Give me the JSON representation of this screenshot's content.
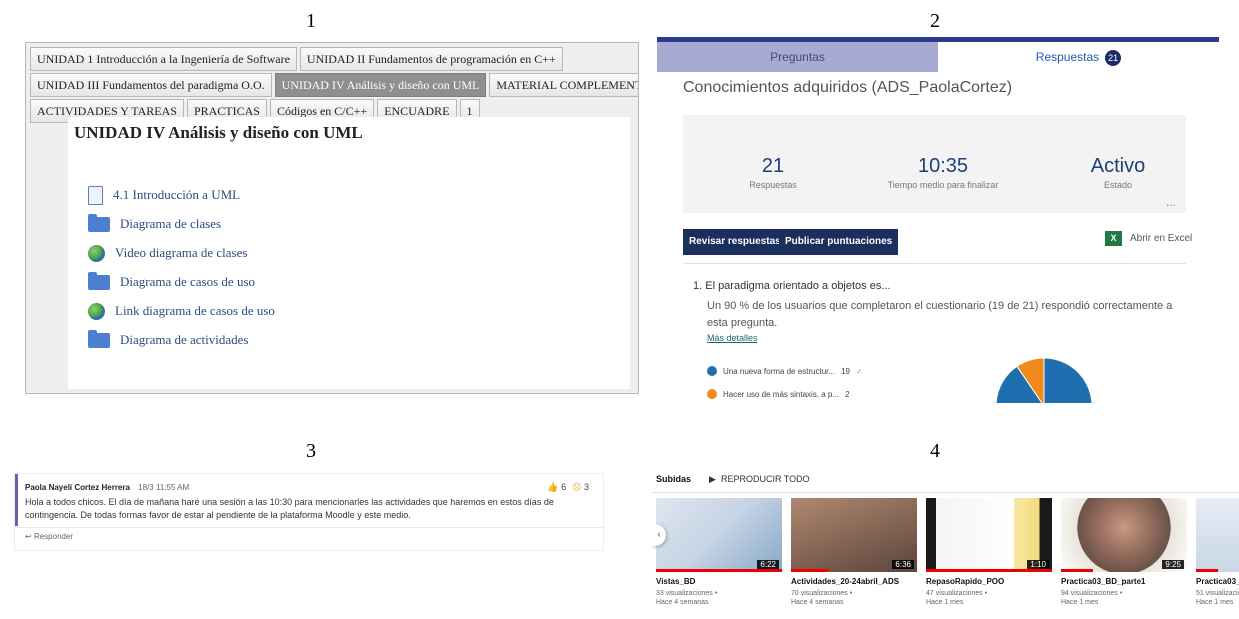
{
  "labels": {
    "n1": "1",
    "n2": "2",
    "n3": "3",
    "n4": "4"
  },
  "moodle": {
    "tabs_row1": [
      "UNIDAD 1 Introducción a la Ingeniería de Software",
      "UNIDAD II Fundamentos de programación en C++"
    ],
    "tabs_row2": [
      "UNIDAD III Fundamentos del paradigma O.O.",
      "UNIDAD IV Análisis y diseño con UML",
      "MATERIAL COMPLEMENTARIO"
    ],
    "tabs_row3": [
      "ACTIVIDADES Y TAREAS",
      "PRACTICAS",
      "Códigos en C/C++",
      "ENCUADRE",
      "1"
    ],
    "active_tab": "UNIDAD IV Análisis y diseño con UML",
    "section_title": "UNIDAD IV Análisis y diseño con UML",
    "resources": [
      {
        "icon": "document-icon",
        "label": "4.1 Introducción a UML"
      },
      {
        "icon": "folder-icon",
        "label": "Diagrama de clases"
      },
      {
        "icon": "globe-icon",
        "label": "Video diagrama de clases"
      },
      {
        "icon": "folder-icon",
        "label": "Diagrama de casos de uso"
      },
      {
        "icon": "globe-icon",
        "label": "Link diagrama de casos de uso"
      },
      {
        "icon": "folder-icon",
        "label": "Diagrama de actividades"
      }
    ]
  },
  "forms": {
    "tab_questions": "Preguntas",
    "tab_responses": "Respuestas",
    "responses_badge": "21",
    "heading": "Conocimientos adquiridos (ADS_PaolaCortez)",
    "stats": [
      {
        "value": "21",
        "label": "Respuestas"
      },
      {
        "value": "10:35",
        "label": "Tiempo medio para finalizar"
      },
      {
        "value": "Activo",
        "label": "Estado"
      }
    ],
    "more_options": "...",
    "review_button": "Revisar respuestas",
    "publish_button": "Publicar puntuaciones",
    "excel_link": "Abrir en Excel",
    "question": "1. El paradigma orientado a objetos es...",
    "question_desc": "Un 90 % de los usuarios que completaron el cuestionario (19 de 21) respondió correctamente a esta pregunta.",
    "more_details": "Más detalles",
    "options": [
      {
        "label": "Una nueva forma de estructur...",
        "count": "19",
        "check": "✓",
        "color": "#1f6fb0"
      },
      {
        "label": "Hacer uso de más sintaxis, a p...",
        "count": "2",
        "check": "",
        "color": "#f28a1b"
      }
    ],
    "chart_data": {
      "type": "pie",
      "categories": [
        "Una nueva forma de estructur...",
        "Hacer uso de más sintaxis, a p..."
      ],
      "values": [
        19,
        2
      ],
      "colors": [
        "#1f6fb0",
        "#f28a1b"
      ]
    }
  },
  "teams": {
    "author": "Paola Nayeli Cortez Herrera",
    "time": "18/3 11:55 AM",
    "likes": "6",
    "sad": "3",
    "message": "Hola a todos chicos. El día de mañana haré una sesión a las 10:30 para mencionarles las actividades que haremos en estos días de contingencia. De todas formas favor de estar al pendiente de la plataforma Moodle y este medio.",
    "reply": "Responder"
  },
  "youtube": {
    "section": "Subidas",
    "play_all": "REPRODUCIR TODO",
    "videos": [
      {
        "title": "Vistas_BD",
        "views": "33 visualizaciones •",
        "age": "Hace 4 semanas",
        "duration": "6:22",
        "watched": 1.0
      },
      {
        "title": "Actividades_20-24abril_ADS",
        "views": "70 visualizaciones •",
        "age": "Hace 4 semanas",
        "duration": "6:36",
        "watched": 0.3
      },
      {
        "title": "RepasoRapido_POO",
        "views": "47 visualizaciones •",
        "age": "Hace 1 mes",
        "duration": "1:10",
        "watched": 1.0
      },
      {
        "title": "Practica03_BD_parte1",
        "views": "94 visualizaciones •",
        "age": "Hace 1 mes",
        "duration": "9:25",
        "watched": 0.25
      },
      {
        "title": "Practica03_",
        "views": "51 visualizaciones",
        "age": "Hace 1 mes",
        "duration": "",
        "watched": 0.5
      }
    ]
  }
}
